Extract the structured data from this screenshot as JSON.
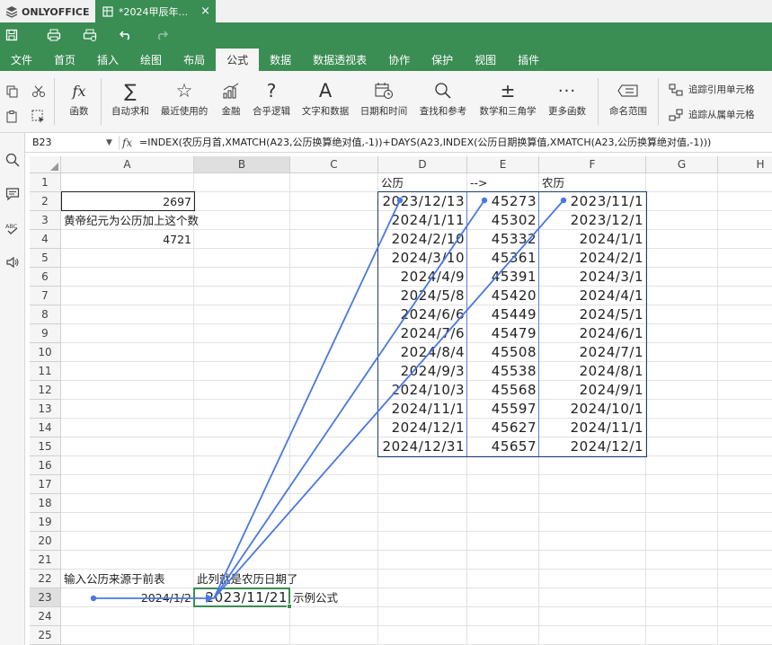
{
  "app": {
    "brand": "ONLYOFFICE",
    "document_tab": "*2024甲辰年...",
    "tab_close": "×"
  },
  "menu": {
    "items": [
      "文件",
      "首页",
      "插入",
      "绘图",
      "布局",
      "公式",
      "数据",
      "数据透视表",
      "协作",
      "保护",
      "视图",
      "插件"
    ],
    "active": "公式"
  },
  "ribbon": {
    "function_label": "函数",
    "autosum_label": "自动求和",
    "recent_label": "最近使用的",
    "financial_label": "金融",
    "logical_label": "合乎逻辑",
    "text_label": "文字和数据",
    "datetime_label": "日期和时间",
    "lookup_label": "查找和参考",
    "math_label": "数学和三角学",
    "more_label": "更多函数",
    "named_range_label": "命名范围",
    "trace_precedents_label": "追踪引用单元格",
    "trace_dependents_label": "追踪从属单元格"
  },
  "formula_bar": {
    "cell_ref": "B23",
    "fx_symbol": "fx",
    "formula": "=INDEX(农历月首,XMATCH(A23,公历换算绝对值,-1))+DAYS(A23,INDEX(公历日期换算值,XMATCH(A23,公历换算绝对值,-1)))"
  },
  "sheet": {
    "columns": [
      "A",
      "B",
      "C",
      "D",
      "E",
      "F",
      "G",
      "H"
    ],
    "selected_column": "B",
    "rows": [
      "1",
      "2",
      "3",
      "4",
      "5",
      "6",
      "7",
      "8",
      "9",
      "10",
      "11",
      "12",
      "13",
      "14",
      "15",
      "16",
      "17",
      "18",
      "19",
      "20",
      "21",
      "22",
      "23",
      "24",
      "25"
    ],
    "selected_row": "23",
    "cells": {
      "A2": "2697",
      "A3": "黄帝纪元为公历加上这个数",
      "A4": "4721",
      "A22": "输入公历来源于前表",
      "B22": "此列就是农历日期了",
      "A23": "2024/1/2",
      "B23": "2023/11/21",
      "C23": "示例公式"
    },
    "table": {
      "headers": [
        "公历",
        "-->",
        "农历"
      ],
      "gregorian": [
        "2023/12/13",
        "2024/1/11",
        "2024/2/10",
        "2024/3/10",
        "2024/4/9",
        "2024/5/8",
        "2024/6/6",
        "2024/7/6",
        "2024/8/4",
        "2024/9/3",
        "2024/10/3",
        "2024/11/1",
        "2024/12/1",
        "2024/12/31"
      ],
      "serials": [
        "45273",
        "45302",
        "45332",
        "45361",
        "45391",
        "45420",
        "45449",
        "45479",
        "45508",
        "45538",
        "45568",
        "45597",
        "45627",
        "45657"
      ],
      "lunar": [
        "2023/11/1",
        "2023/12/1",
        "2024/1/1",
        "2024/2/1",
        "2024/3/1",
        "2024/4/1",
        "2024/5/1",
        "2024/6/1",
        "2024/7/1",
        "2024/8/1",
        "2024/9/1",
        "2024/10/1",
        "2024/11/1",
        "2024/12/1"
      ]
    }
  },
  "colors": {
    "accent_green": "#3a8d53",
    "trace_arrow": "#4a78e0",
    "table_border": "#1f3b73"
  }
}
